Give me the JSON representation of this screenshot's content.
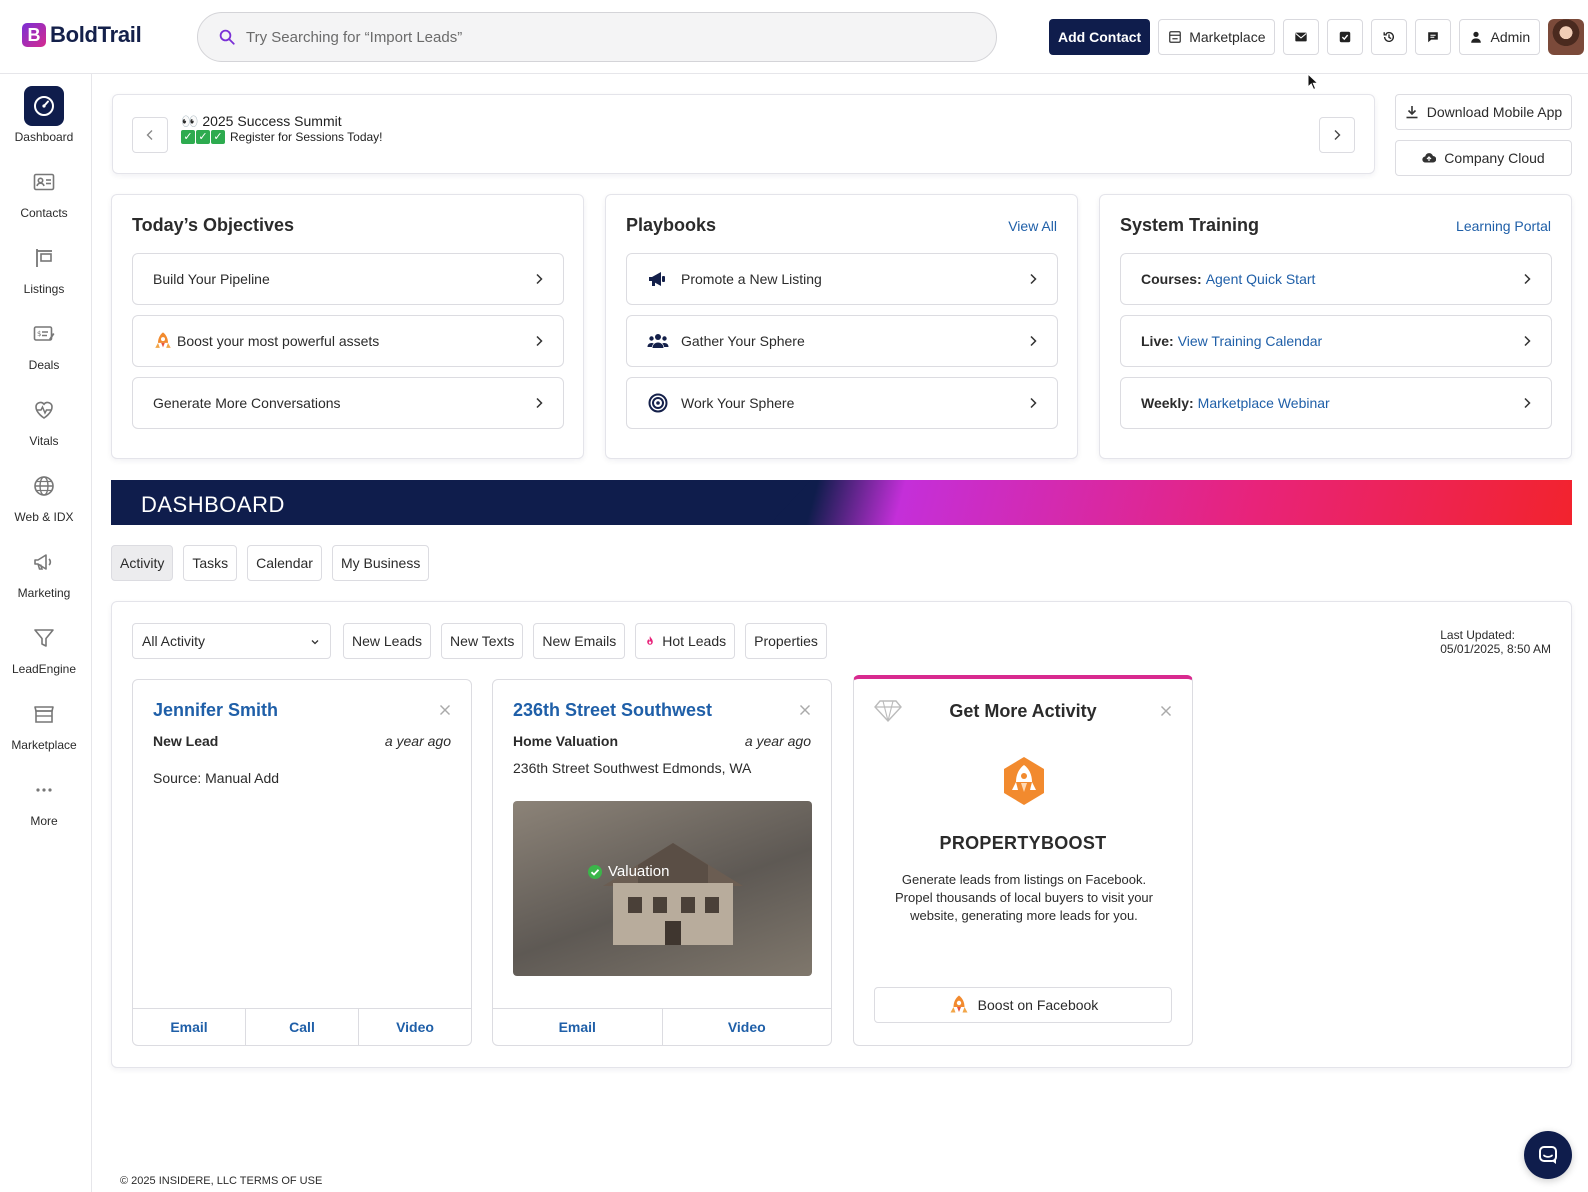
{
  "brand": {
    "name": "BoldTrail",
    "mark": "B"
  },
  "search": {
    "placeholder": "Try Searching for “Import Leads”"
  },
  "header": {
    "add_contact": "Add Contact",
    "marketplace": "Marketplace",
    "admin": "Admin"
  },
  "sidebar": {
    "items": [
      {
        "label": "Dashboard",
        "icon": "gauge-icon"
      },
      {
        "label": "Contacts",
        "icon": "contact-card-icon"
      },
      {
        "label": "Listings",
        "icon": "sign-post-icon"
      },
      {
        "label": "Deals",
        "icon": "deal-card-icon"
      },
      {
        "label": "Vitals",
        "icon": "heart-pulse-icon"
      },
      {
        "label": "Web & IDX",
        "icon": "globe-icon"
      },
      {
        "label": "Marketing",
        "icon": "megaphone-icon"
      },
      {
        "label": "LeadEngine",
        "icon": "funnel-icon"
      },
      {
        "label": "Marketplace",
        "icon": "storefront-icon"
      },
      {
        "label": "More",
        "icon": "more-dots-icon"
      }
    ]
  },
  "summit": {
    "title": "👀 2025 Success Summit",
    "subtitle": "Register for Sessions Today!"
  },
  "side_buttons": {
    "download_app": "Download Mobile App",
    "company_cloud": "Company Cloud"
  },
  "objectives": {
    "title": "Today’s Objectives",
    "items": [
      "Build Your Pipeline",
      "Boost your most powerful assets",
      "Generate More Conversations"
    ]
  },
  "playbooks": {
    "title": "Playbooks",
    "link": "View All",
    "items": [
      "Promote a New Listing",
      "Gather Your Sphere",
      "Work Your Sphere"
    ]
  },
  "training": {
    "title": "System Training",
    "link": "Learning Portal",
    "items": [
      {
        "prefix": "Courses:",
        "link": "Agent Quick Start"
      },
      {
        "prefix": "Live:",
        "link": "View Training Calendar"
      },
      {
        "prefix": "Weekly:",
        "link": "Marketplace Webinar"
      }
    ]
  },
  "dashboard": {
    "title": "DASHBOARD",
    "tabs": [
      "Activity",
      "Tasks",
      "Calendar",
      "My Business"
    ]
  },
  "activity": {
    "select_value": "All Activity",
    "filters": [
      "New Leads",
      "New Texts",
      "New Emails",
      "Hot Leads",
      "Properties"
    ],
    "last_updated_label": "Last Updated:",
    "last_updated_value": "05/01/2025, 8:50 AM"
  },
  "cards": [
    {
      "title": "Jennifer Smith",
      "type": "New Lead",
      "time": "a year ago",
      "detail": "Source: Manual Add",
      "actions": [
        "Email",
        "Call",
        "Video"
      ]
    },
    {
      "title": "236th Street Southwest",
      "type": "Home Valuation",
      "time": "a year ago",
      "detail": "236th Street Southwest Edmonds, WA",
      "image_label": "Valuation",
      "actions": [
        "Email",
        "Video"
      ]
    }
  ],
  "promo": {
    "title": "Get More Activity",
    "name": "PROPERTYBOOST",
    "text": "Generate leads from listings on Facebook. Propel thousands of local buyers to visit your website, generating more leads for you.",
    "button": "Boost on Facebook"
  },
  "footer": {
    "text": "© 2025 INSIDERE, LLC TERMS OF USE"
  },
  "colors": {
    "navy": "#0f1d4c",
    "link": "#1f5fa8",
    "accent_pink": "#d82a8f",
    "accent_red": "#f2232d"
  }
}
